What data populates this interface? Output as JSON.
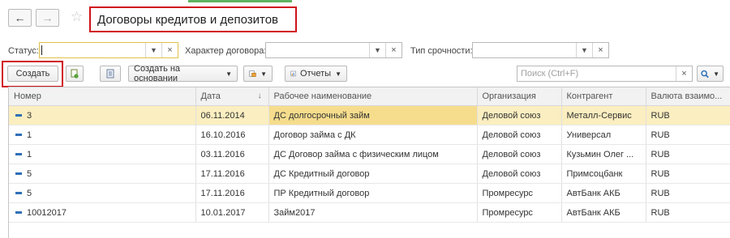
{
  "window": {
    "title": "Договоры кредитов и депозитов"
  },
  "nav": {
    "back_icon": "arrow-left-icon",
    "forward_icon": "arrow-right-icon",
    "favorite_icon": "star-icon"
  },
  "filters": {
    "status": {
      "label": "Статус:",
      "value": ""
    },
    "contract_type": {
      "label": "Характер договора:",
      "value": ""
    },
    "term_type": {
      "label": "Тип срочности:",
      "value": ""
    }
  },
  "toolbar": {
    "create_label": "Создать",
    "create_based_label": "Создать на основании",
    "reports_label": "Отчеты",
    "search_placeholder": "Поиск (Ctrl+F)"
  },
  "table": {
    "columns": [
      "Номер",
      "Дата",
      "Рабочее наименование",
      "Организация",
      "Контрагент",
      "Валюта взаимо..."
    ],
    "sorted_column": "Дата",
    "rows": [
      {
        "number": "3",
        "date": "06.11.2014",
        "name": "ДС долгосрочный займ",
        "org": "Деловой союз",
        "counterparty": "Металл-Сервис",
        "currency": "RUB",
        "selected": true
      },
      {
        "number": "1",
        "date": "16.10.2016",
        "name": "Договор займа с ДК",
        "org": "Деловой союз",
        "counterparty": "Универсал",
        "currency": "RUB"
      },
      {
        "number": "1",
        "date": "03.11.2016",
        "name": "ДС Договор займа с физическим лицом",
        "org": "Деловой союз",
        "counterparty": "Кузьмин Олег ...",
        "currency": "RUB"
      },
      {
        "number": "5",
        "date": "17.11.2016",
        "name": "ДС Кредитный договор",
        "org": "Деловой союз",
        "counterparty": "Примсоцбанк",
        "currency": "RUB"
      },
      {
        "number": "5",
        "date": "17.11.2016",
        "name": "ПР Кредитный договор",
        "org": "Промресурс",
        "counterparty": "АвтБанк АКБ",
        "currency": "RUB"
      },
      {
        "number": "10012017",
        "date": "10.01.2017",
        "name": "Займ2017",
        "org": "Промресурс",
        "counterparty": "АвтБанк АКБ",
        "currency": "RUB"
      }
    ]
  },
  "colors": {
    "highlight_border": "#d0111b",
    "selected_row": "#fbeec0",
    "selected_cell": "#f6dd8d",
    "row_icon": "#2e6fb7"
  }
}
